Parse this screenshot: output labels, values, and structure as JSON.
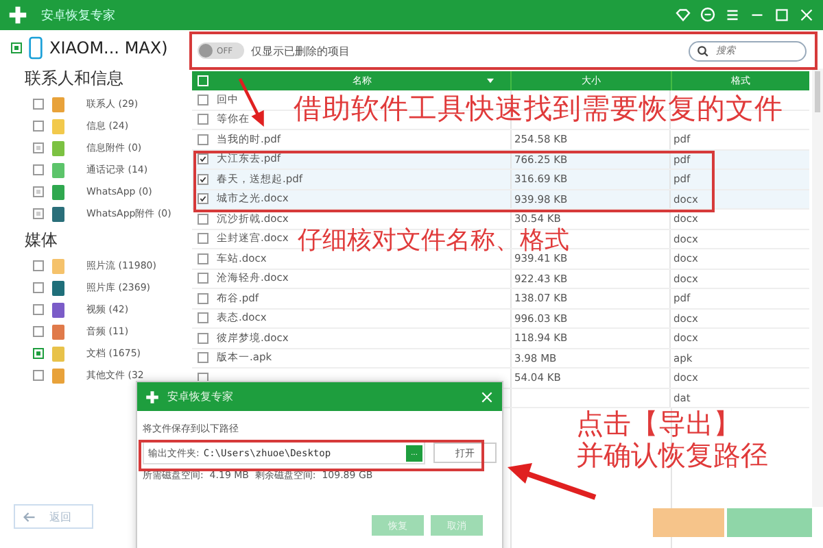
{
  "window": {
    "title": "安卓恢复专家"
  },
  "device": {
    "name": "XIAOM... MAX)",
    "checked": true
  },
  "sidebar": [
    {
      "heading": "联系人和信息",
      "items": [
        {
          "label": "联系人 (29)",
          "checked": false,
          "disabled": false,
          "color": "#e8a23a"
        },
        {
          "label": "信息 (24)",
          "checked": false,
          "disabled": false,
          "color": "#f2c94c"
        },
        {
          "label": "信息附件 (0)",
          "checked": false,
          "disabled": true,
          "color": "#7cc242"
        },
        {
          "label": "通话记录 (14)",
          "checked": false,
          "disabled": false,
          "color": "#5cc46a"
        },
        {
          "label": "WhatsApp (0)",
          "checked": false,
          "disabled": true,
          "color": "#2fa84f"
        },
        {
          "label": "WhatsApp附件 (0)",
          "checked": false,
          "disabled": true,
          "color": "#2a6f7a"
        }
      ]
    },
    {
      "heading": "媒体",
      "items": [
        {
          "label": "照片流 (11980)",
          "checked": false,
          "disabled": false,
          "color": "#f5c26b"
        },
        {
          "label": "照片库 (2369)",
          "checked": false,
          "disabled": false,
          "color": "#1f6f7a"
        },
        {
          "label": "视频 (42)",
          "checked": false,
          "disabled": false,
          "color": "#7b5cc8"
        },
        {
          "label": "音频 (11)",
          "checked": false,
          "disabled": false,
          "color": "#e07a4a"
        },
        {
          "label": "文档 (1675)",
          "checked": true,
          "disabled": false,
          "color": "#e8c24a"
        },
        {
          "label": "其他文件 (32",
          "checked": false,
          "disabled": false,
          "color": "#e8a23a"
        }
      ]
    }
  ],
  "back_button": "返回",
  "toolbar": {
    "toggle": {
      "label": "OFF",
      "on": false
    },
    "filter_label": "仅显示已删除的项目",
    "search": {
      "placeholder": "搜索"
    }
  },
  "table": {
    "all_checked": false,
    "columns": [
      "名称",
      "大小",
      "格式"
    ],
    "rows": [
      {
        "name": "回中",
        "checked": false
      },
      {
        "name": "等你在",
        "checked": false
      },
      {
        "name": "当我的时.pdf",
        "size": "254.58 KB",
        "format": "pdf",
        "checked": false
      },
      {
        "name": "大江东去.pdf",
        "size": "766.25 KB",
        "format": "pdf",
        "checked": true
      },
      {
        "name": "春天，送想起.pdf",
        "size": "316.69 KB",
        "format": "pdf",
        "checked": true
      },
      {
        "name": "城市之光.docx",
        "size": "939.98 KB",
        "format": "docx",
        "checked": true
      },
      {
        "name": "沉沙折戟.docx",
        "size": "30.54 KB",
        "format": "docx",
        "checked": false
      },
      {
        "name": "尘封迷宫.docx",
        "format": "docx",
        "checked": false
      },
      {
        "name": "车站.docx",
        "size": "939.41 KB",
        "format": "docx",
        "checked": false
      },
      {
        "name": "沧海轻舟.docx",
        "size": "922.43 KB",
        "format": "docx",
        "checked": false
      },
      {
        "name": "布谷.pdf",
        "size": "138.07 KB",
        "format": "pdf",
        "checked": false
      },
      {
        "name": "表态.docx",
        "size": "996.03 KB",
        "format": "docx",
        "checked": false
      },
      {
        "name": "彼岸梦境.docx",
        "size": "118.94 KB",
        "format": "docx",
        "checked": false
      },
      {
        "name": "版本一.apk",
        "size": "3.98 MB",
        "format": "apk",
        "checked": false
      },
      {
        "size": "54.04 KB",
        "format": "docx",
        "checked": false
      },
      {
        "format": "dat"
      }
    ]
  },
  "dialog": {
    "title": "安卓恢复专家",
    "prompt": "将文件保存到以下路径",
    "folder_label": "输出文件夹:",
    "folder_value": "C:\\Users\\zhuoe\\Desktop",
    "browse_button": "...",
    "open_button": "打开",
    "space_info": "所需磁盘空间:  4.19 MB  剩余磁盘空间:  109.89 GB",
    "buttons": [
      "恢复",
      "取消"
    ]
  },
  "annotations": [
    {
      "lines": [
        "借助软件工具快速找到需要恢复的文件"
      ]
    },
    {
      "lines": [
        "仔细核对文件名称、格式"
      ]
    },
    {
      "lines": [
        "点击【导出】",
        "并确认恢复路径"
      ]
    }
  ]
}
